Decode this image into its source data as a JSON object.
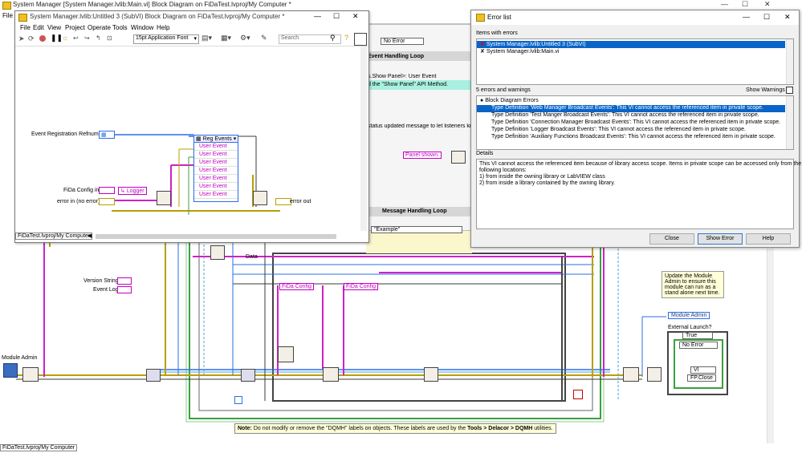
{
  "main": {
    "title": "System Manager [System Manager.lvlib:Main.vi] Block Diagram on FiDaTest.lvproj/My Computer *",
    "menu_file": "File",
    "status_path": "FiDaTest.lvproj/My Computer",
    "labels": {
      "module_admin": "Module Admin",
      "version_string": "Version String",
      "event_log": "Event Log",
      "data": "Data",
      "fida_config_1": "FiDa Config",
      "fida_config_2": "FiDa Config",
      "event_handling_loop": "Event Handling Loop",
      "message_handling_loop": "Message Handling Loop",
      "show_panel_event": "s.Show Panel>: User Event",
      "show_panel_method": "d the \"Show Panel\" API Method.",
      "status_msg": "status updated message to let listeners know",
      "panel_shown": "Panel shown.",
      "no_error": "No Error",
      "example": "\"Example\"",
      "module_admin_ref": "Module Admin",
      "external_launch": "External Launch?",
      "true_case": "True",
      "no_error_case": "No Error",
      "fp_close": "FP.Close",
      "vi": "VI",
      "update_note": "Update the Module Admin to ensure this module can run as a stand alone next time."
    },
    "note_prefix": "Note:",
    "note_text": " Do not modify or remove the \"DQMH\" labels on objects. These labels are used by the ",
    "note_tools": "Tools > Delacor > DQMH",
    "note_suffix": " utilities."
  },
  "subvi": {
    "title": "System Manager.lvlib:Untitled 3 (SubVI) Block Diagram on FiDaTest.lvproj/My Computer *",
    "menu": [
      "File",
      "Edit",
      "View",
      "Project",
      "Operate",
      "Tools",
      "Window",
      "Help"
    ],
    "font": "15pt Application Font",
    "search_placeholder": "Search",
    "status_path": "FiDaTest.lvproj/My Computer",
    "labels": {
      "event_refnum": "Event Registration Refnum in",
      "fida_config": "FiDa Config in",
      "error_in": "error in (no error)",
      "error_out": "error out",
      "logger": "Logger",
      "reg_events": "Reg Events",
      "user_event": [
        "User Event",
        "User Event",
        "User Event",
        "User Event",
        "User Event",
        "User Event",
        "User Event"
      ]
    }
  },
  "error_list": {
    "title": "Error list",
    "items_label": "Items with errors",
    "items": [
      "System Manager.lvlib:Untitled 3 (SubVI)",
      "System Manager.lvlib:Main.vi"
    ],
    "count_label": "5 errors and warnings",
    "show_warnings": "Show Warnings",
    "group": "Block Diagram Errors",
    "errors": [
      "Type Definition 'Web Manager Broadcast Events': This VI cannot access the referenced item in private scope.",
      "Type Definition 'Test Manger Broadcast Events': This VI cannot access the referenced item in private scope.",
      "Type Definition 'Connection Manager Broadcast Events': This VI cannot access the referenced item in private scope.",
      "Type Definition 'Logger Broadcast Events': This VI cannot access the referenced item in private scope.",
      "Type Definition 'Auxiliary Functions Broadcast Events': This VI cannot access the referenced item in private scope."
    ],
    "details_label": "Details",
    "details": [
      "This VI cannot access the referenced item because of library access scope. Items in private scope can be accessed only from the",
      "following locations:",
      "1) from inside the owning library or LabVIEW class",
      "2) from inside a library contained by the owning library."
    ],
    "buttons": {
      "close": "Close",
      "show_error": "Show Error",
      "help": "Help"
    }
  },
  "colors": {
    "selection": "#0a64c8",
    "wire_blue": "#2a6ee8",
    "wire_pink": "#d020c8",
    "wire_green": "#3aa040",
    "wire_yellow": "#b8a000",
    "error_red": "#cc1010"
  }
}
